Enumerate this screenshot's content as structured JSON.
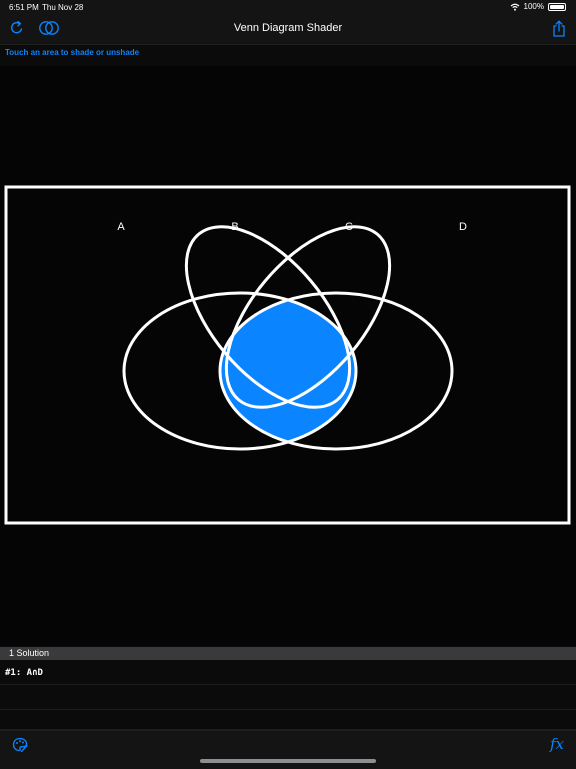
{
  "status_bar": {
    "time": "6:51 PM",
    "date": "Thu Nov 28",
    "battery": "100%",
    "icons": [
      "wifi-icon",
      "battery-icon"
    ]
  },
  "nav": {
    "title": "Venn Diagram Shader",
    "left_buttons": [
      "refresh-icon",
      "venn-sets-icon"
    ],
    "right_buttons": [
      "share-icon"
    ]
  },
  "hint": "Touch an area to shade or unshade",
  "diagram": {
    "set_labels": [
      "A",
      "B",
      "C",
      "D"
    ],
    "shaded_region": "A∩D",
    "outline_color": "#ffffff",
    "shade_color": "#0a84ff",
    "background": "#050505"
  },
  "solutions": {
    "header": "1 Solution",
    "items": [
      "#1: A∩D",
      "",
      ""
    ]
  },
  "bottom_bar": {
    "palette_icon": "palette-icon",
    "fx_label": "fx"
  },
  "colors": {
    "accent": "#0a84ff",
    "bar_background": "#141414",
    "section_header": "#3a3a3c"
  }
}
